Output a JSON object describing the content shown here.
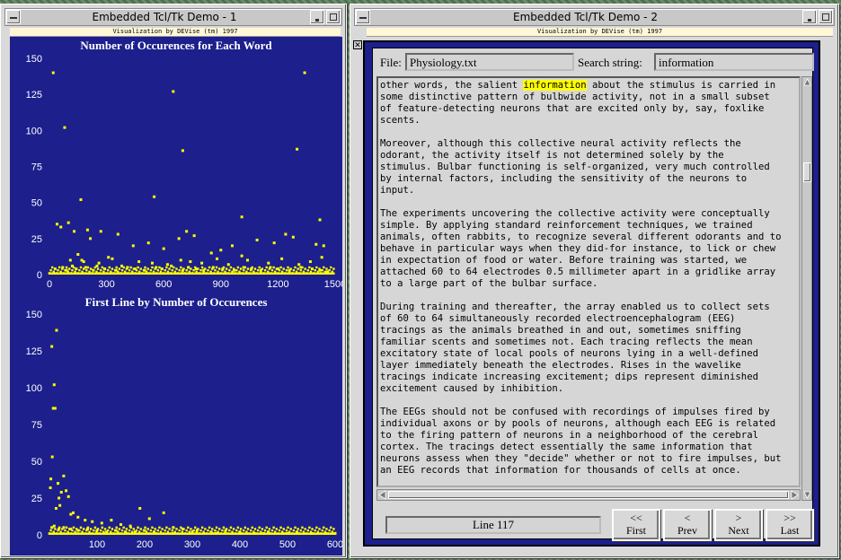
{
  "colors": {
    "plot_bg": "#1c1f8c",
    "points": "#ffff00",
    "highlight": "#ffff00"
  },
  "left_window": {
    "title": "Embedded Tcl/Tk Demo - 1",
    "banner": "Visualization by DEVise (tm) 1997",
    "chart_data": [
      {
        "type": "scatter",
        "title": "Number of Occurences for Each Word",
        "xlabel": "",
        "ylabel": "",
        "xlim": [
          0,
          1500
        ],
        "ylim": [
          0,
          150
        ],
        "xticks": [
          "0",
          "300",
          "600",
          "900",
          "1200",
          "1500"
        ],
        "yticks": [
          "0",
          "25",
          "50",
          "75",
          "100",
          "125",
          "150"
        ],
        "grid": false,
        "x": [
          20,
          80,
          100,
          165,
          270,
          550,
          650,
          700,
          1010,
          1300,
          1340,
          1420,
          40,
          60,
          130,
          200,
          215,
          310,
          360,
          440,
          520,
          600,
          680,
          720,
          760,
          850,
          900,
          960,
          1010,
          1090,
          1180,
          1240,
          1280,
          1400,
          1440,
          110,
          150,
          170,
          180,
          260,
          330,
          380,
          470,
          540,
          620,
          690,
          740,
          800,
          880,
          940,
          1040,
          1150,
          1220,
          1310,
          1370,
          1430,
          30,
          70,
          90,
          120,
          140,
          190,
          230,
          250,
          290,
          350,
          410,
          450,
          500,
          560,
          590,
          640,
          700,
          730,
          770,
          810,
          860,
          910,
          970,
          1020,
          1060,
          1110,
          1160,
          1200,
          1260,
          1320,
          1380,
          1420,
          1460
        ],
        "y": [
          140,
          102,
          36,
          52,
          30,
          54,
          127,
          86,
          40,
          87,
          140,
          38,
          35,
          33,
          30,
          31,
          25,
          12,
          28,
          20,
          22,
          18,
          25,
          30,
          27,
          15,
          17,
          20,
          13,
          24,
          22,
          28,
          26,
          21,
          20,
          10,
          14,
          10,
          9,
          8,
          11,
          6,
          9,
          8,
          7,
          10,
          9,
          8,
          11,
          7,
          10,
          8,
          11,
          7,
          9,
          12,
          4,
          5,
          3,
          6,
          4,
          5,
          3,
          6,
          4,
          3,
          5,
          4,
          3,
          5,
          4,
          6,
          3,
          5,
          4,
          3,
          5,
          4,
          3,
          5,
          4,
          3,
          5,
          4,
          3,
          5,
          4,
          3,
          2
        ]
      },
      {
        "type": "scatter",
        "title": "First Line by Number of Occurences",
        "xlabel": "",
        "ylabel": "",
        "xlim": [
          0,
          600
        ],
        "ylim": [
          0,
          150
        ],
        "xticks": [
          "100",
          "200",
          "300",
          "400",
          "500",
          "600"
        ],
        "yticks": [
          "0",
          "25",
          "50",
          "75",
          "100",
          "125",
          "150"
        ],
        "grid": false,
        "x": [
          5,
          10,
          15,
          12,
          8,
          6,
          30,
          3,
          18,
          2,
          25,
          20,
          40,
          35,
          22,
          14,
          50,
          45,
          60,
          75,
          90,
          110,
          130,
          150,
          170,
          190,
          210,
          240,
          260,
          280,
          310,
          340,
          370,
          400,
          430,
          460,
          490,
          520,
          550,
          580,
          600,
          5,
          10,
          20,
          30,
          45,
          60,
          80,
          100,
          120,
          140,
          160,
          180,
          200,
          220,
          260,
          300,
          350,
          400,
          450,
          500,
          550,
          600
        ],
        "y": [
          128,
          102,
          139,
          86,
          86,
          53,
          40,
          38,
          35,
          32,
          29,
          25,
          26,
          30,
          20,
          18,
          15,
          14,
          12,
          10,
          9,
          8,
          10,
          7,
          6,
          18,
          11,
          15,
          5,
          4,
          3,
          2,
          3,
          2,
          1,
          2,
          1,
          2,
          1,
          1,
          1,
          5,
          6,
          4,
          5,
          4,
          3,
          4,
          3,
          2,
          3,
          2,
          2,
          3,
          2,
          1,
          2,
          1,
          1,
          1,
          1,
          1,
          1
        ]
      }
    ]
  },
  "right_window": {
    "title": "Embedded Tcl/Tk Demo - 2",
    "banner": "Visualization by DEVise (tm) 1997",
    "file_label": "File:",
    "file_value": "Physiology.txt",
    "search_label": "Search string:",
    "search_value": "information",
    "text_before_highlight": "other words, the salient ",
    "text_highlight": "information",
    "text_after_highlight": " about the stimulus is carried in\nsome distinctive pattern of bulbwide activity, not in a small subset\nof feature-detecting neurons that are excited only by, say, foxlike\nscents.\n\nMoreover, although this collective neural activity reflects the\nodorant, the activity itself is not determined solely by the\nstimulus. Bulbar functioning is self-organized, very much controlled\nby internal factors, including the sensitivity of the neurons to\ninput.\n\nThe experiments uncovering the collective activity were conceptually\nsimple. By applying standard reinforcement techniques, we trained\nanimals, often rabbits, to recognize several different odorants and to\nbehave in particular ways when they did-for instance, to lick or chew\nin expectation of food or water. Before training was started, we\nattached 60 to 64 electrodes 0.5 millimeter apart in a gridlike array\nto a large part of the bulbar surface.\n\nDuring training and thereafter, the array enabled us to collect sets\nof 60 to 64 simultaneously recorded electroencephalogram (EEG)\ntracings as the animals breathed in and out, sometimes sniffing\nfamiliar scents and sometimes not. Each tracing reflects the mean\nexcitatory state of local pools of neurons lying in a well-defined\nlayer immediately beneath the electrodes. Rises in the wavelike\ntracings indicate increasing excitement; dips represent diminished\nexcitement caused by inhibition.\n\nThe EEGs should not be confused with recordings of impulses fired by\nindividual axons or by pools of neurons, although each EEG is related\nto the firing pattern of neurons in a neighborhood of the cerebral\ncortex. The tracings detect essentially the same information that\nneurons assess when they \"decide\" whether or not to fire impulses, but\nan EEG records that information for thousands of cells at once.",
    "status": "Line 117",
    "buttons": [
      {
        "sym": "<<",
        "label": "First"
      },
      {
        "sym": "<",
        "label": "Prev"
      },
      {
        "sym": ">",
        "label": "Next"
      },
      {
        "sym": ">>",
        "label": "Last"
      }
    ]
  }
}
